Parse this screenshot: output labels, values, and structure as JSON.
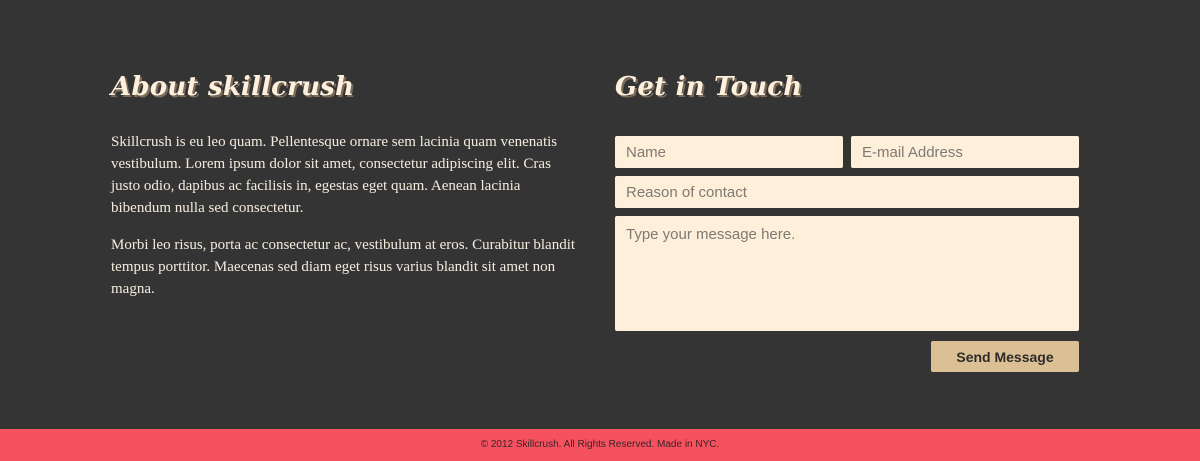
{
  "about": {
    "title": "About skillcrush",
    "paragraphs": [
      "Skillcrush is eu leo quam. Pellentesque ornare sem lacinia quam venenatis vestibulum. Lorem ipsum dolor sit amet, consectetur adipiscing elit. Cras justo odio, dapibus ac facilisis in, egestas eget quam. Aenean lacinia bibendum nulla sed consectetur.",
      "Morbi leo risus, porta ac consectetur ac, vestibulum at eros. Curabitur blandit tempus porttitor. Maecenas sed diam eget risus varius blandit sit amet non magna."
    ]
  },
  "contact": {
    "title": "Get in Touch",
    "name_placeholder": "Name",
    "email_placeholder": "E-mail Address",
    "reason_placeholder": "Reason of contact",
    "message_placeholder": "Type your message here.",
    "submit_label": "Send Message"
  },
  "footer": {
    "copyright": "© 2012 Skillcrush. All Rights Reserved. Made in NYC."
  },
  "colors": {
    "background": "#353434",
    "input_background": "#fdefd9",
    "button": "#dbc096",
    "footer": "#f5515f"
  }
}
